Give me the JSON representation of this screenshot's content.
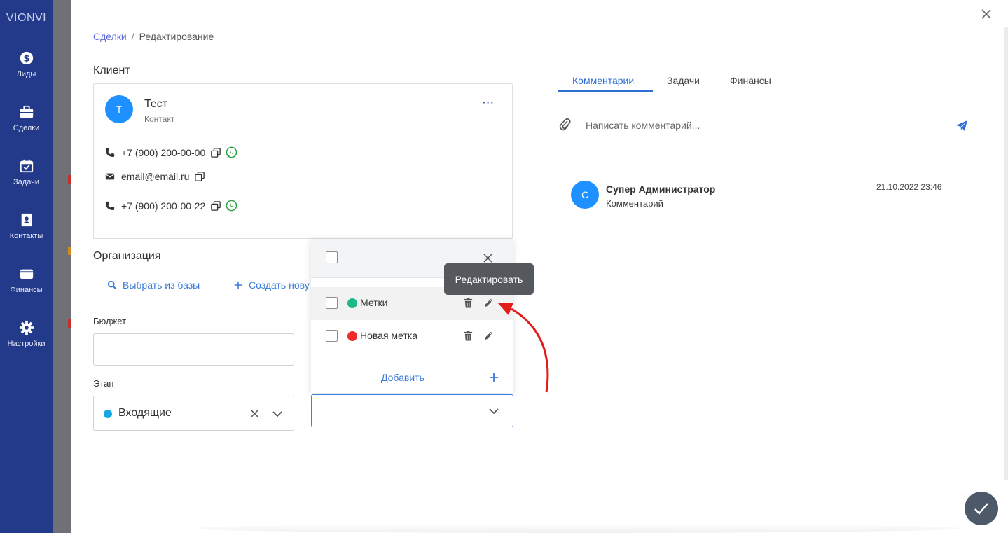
{
  "app": {
    "logo": "VIONVI"
  },
  "sidebar": {
    "items": [
      {
        "label": "Лиды",
        "icon": "dollar-icon"
      },
      {
        "label": "Сделки",
        "icon": "briefcase-icon"
      },
      {
        "label": "Задачи",
        "icon": "calendar-check-icon"
      },
      {
        "label": "Контакты",
        "icon": "contact-book-icon"
      },
      {
        "label": "Финансы",
        "icon": "wallet-icon"
      },
      {
        "label": "Настройки",
        "icon": "gear-icon"
      }
    ]
  },
  "breadcrumb": {
    "link": "Сделки",
    "separator": "/",
    "current": "Редактирование"
  },
  "client": {
    "section_title": "Клиент",
    "avatar_letter": "Т",
    "name": "Тест",
    "type": "Контакт",
    "menu": "···",
    "phone1": "+7 (900) 200-00-00",
    "email": "email@email.ru",
    "phone2": "+7 (900) 200-00-22"
  },
  "organization": {
    "section_title": "Организация",
    "select_from_db": "Выбрать из базы",
    "create_new": "Создать нову"
  },
  "budget": {
    "label": "Бюджет",
    "value": ""
  },
  "stage": {
    "label": "Этап",
    "value": "Входящие",
    "color": "#17a8e3"
  },
  "tags_dropdown": {
    "items": [
      {
        "label": "Метки",
        "color": "#1db98a"
      },
      {
        "label": "Новая метка",
        "color": "#ef2b2b"
      }
    ],
    "add_label": "Добавить"
  },
  "tooltip": {
    "text": "Редактировать"
  },
  "right": {
    "tabs": [
      {
        "label": "Комментарии",
        "active": true
      },
      {
        "label": "Задачи",
        "active": false
      },
      {
        "label": "Финансы",
        "active": false
      }
    ],
    "comment_placeholder": "Написать комментарий...",
    "comments": [
      {
        "avatar_letter": "С",
        "author": "Супер Администратор",
        "text": "Комментарий",
        "date": "21.10.2022 23:46"
      }
    ]
  },
  "colors": {
    "sidebar": "#233a8b",
    "accent": "#2f6fd6",
    "annotation_arrow": "#e31b1b"
  }
}
